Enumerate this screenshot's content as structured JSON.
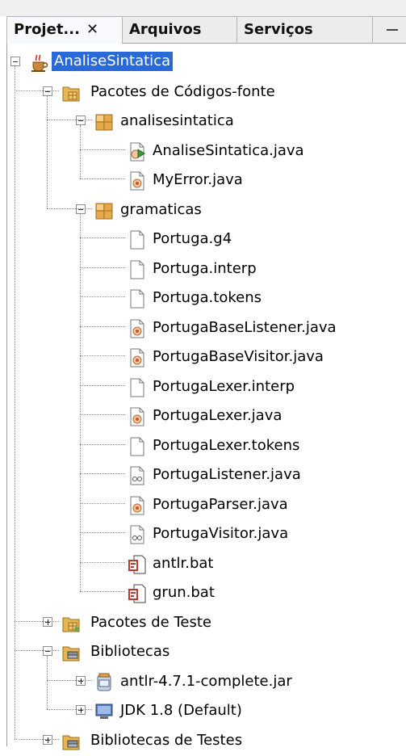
{
  "tabs": [
    {
      "label": "Projet...",
      "close": "✕",
      "active": true
    },
    {
      "label": "Arquivos",
      "active": false
    },
    {
      "label": "Serviços",
      "active": false
    }
  ],
  "colors": {
    "selection": "#2a69d8",
    "package": "#e6a94a",
    "folder": "#e8b650"
  },
  "tree": [
    {
      "label": "AnaliseSintatica",
      "level": 0,
      "icon": "java-project-icon",
      "expander": "minus",
      "selected": true
    },
    {
      "label": "Pacotes de Códigos-fonte",
      "level": 1,
      "icon": "source-packages-icon",
      "expander": "minus"
    },
    {
      "label": "analisesintatica",
      "level": 2,
      "icon": "package-icon",
      "expander": "minus"
    },
    {
      "label": "AnaliseSintatica.java",
      "level": 3,
      "icon": "java-main-class-icon"
    },
    {
      "label": "MyError.java",
      "level": 3,
      "icon": "java-class-icon"
    },
    {
      "label": "gramaticas",
      "level": 2,
      "icon": "package-icon",
      "expander": "minus"
    },
    {
      "label": "Portuga.g4",
      "level": 3,
      "icon": "file-icon"
    },
    {
      "label": "Portuga.interp",
      "level": 3,
      "icon": "file-icon"
    },
    {
      "label": "Portuga.tokens",
      "level": 3,
      "icon": "file-icon"
    },
    {
      "label": "PortugaBaseListener.java",
      "level": 3,
      "icon": "java-class-icon"
    },
    {
      "label": "PortugaBaseVisitor.java",
      "level": 3,
      "icon": "java-class-icon"
    },
    {
      "label": "PortugaLexer.interp",
      "level": 3,
      "icon": "file-icon"
    },
    {
      "label": "PortugaLexer.java",
      "level": 3,
      "icon": "java-class-icon"
    },
    {
      "label": "PortugaLexer.tokens",
      "level": 3,
      "icon": "file-icon"
    },
    {
      "label": "PortugaListener.java",
      "level": 3,
      "icon": "java-interface-icon"
    },
    {
      "label": "PortugaParser.java",
      "level": 3,
      "icon": "java-class-icon"
    },
    {
      "label": "PortugaVisitor.java",
      "level": 3,
      "icon": "java-interface-icon"
    },
    {
      "label": "antlr.bat",
      "level": 3,
      "icon": "bat-file-icon"
    },
    {
      "label": "grun.bat",
      "level": 3,
      "icon": "bat-file-icon"
    },
    {
      "label": "Pacotes de Teste",
      "level": 1,
      "icon": "test-packages-icon",
      "expander": "plus"
    },
    {
      "label": "Bibliotecas",
      "level": 1,
      "icon": "libraries-icon",
      "expander": "minus"
    },
    {
      "label": "antlr-4.7.1-complete.jar",
      "level": 2,
      "icon": "jar-icon",
      "expander": "plus"
    },
    {
      "label": "JDK 1.8 (Default)",
      "level": 2,
      "icon": "jdk-icon",
      "expander": "plus"
    },
    {
      "label": "Bibliotecas de Testes",
      "level": 1,
      "icon": "test-libraries-icon",
      "expander": "plus"
    }
  ]
}
